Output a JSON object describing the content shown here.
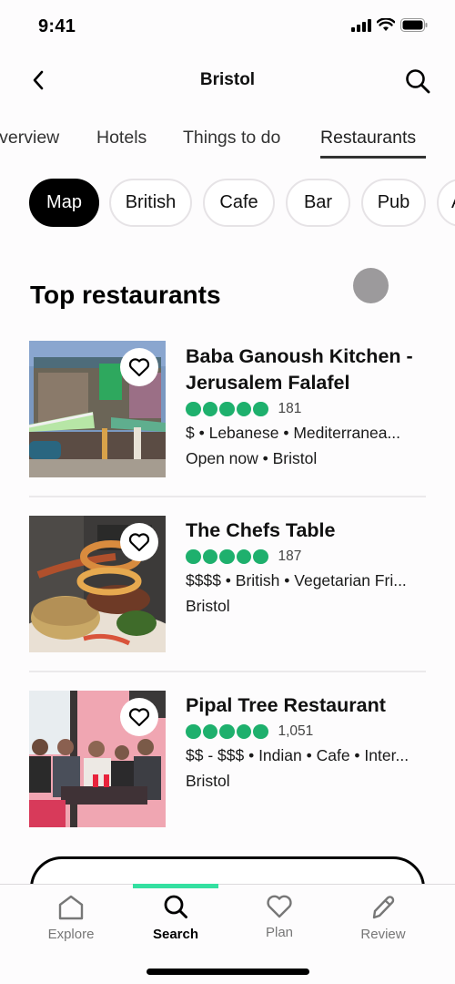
{
  "status_bar": {
    "time": "9:41"
  },
  "nav": {
    "title": "Bristol",
    "back_icon": "chevron-left-icon",
    "search_icon": "search-icon"
  },
  "tabs": [
    {
      "label": "Overview",
      "active": false
    },
    {
      "label": "Hotels",
      "active": false
    },
    {
      "label": "Things to do",
      "active": false
    },
    {
      "label": "Restaurants",
      "active": true
    }
  ],
  "chips": [
    {
      "label": "Map",
      "active": true
    },
    {
      "label": "British",
      "active": false
    },
    {
      "label": "Cafe",
      "active": false
    },
    {
      "label": "Bar",
      "active": false
    },
    {
      "label": "Pub",
      "active": false
    },
    {
      "label": "A",
      "active": false
    }
  ],
  "section": {
    "title": "Top restaurants"
  },
  "restaurants": [
    {
      "name": "Baba Ganoush Kitchen - Jerusalem Falafel",
      "rating": 5,
      "reviews": "181",
      "meta": "$ • Lebanese • Mediterranea...",
      "meta2": "Open now • Bristol",
      "image": "storefront-photo"
    },
    {
      "name": "The Chefs Table",
      "rating": 5,
      "reviews": "187",
      "meta": "$$$$ • British • Vegetarian Fri...",
      "meta2": "Bristol",
      "image": "food-plate-photo"
    },
    {
      "name": "Pipal Tree Restaurant",
      "rating": 5,
      "reviews": "1,051",
      "meta": "$$ - $$$ • Indian • Cafe • Inter...",
      "meta2": "Bristol",
      "image": "group-diners-photo"
    }
  ],
  "bottom_nav": [
    {
      "label": "Explore",
      "icon": "home-icon",
      "active": false
    },
    {
      "label": "Search",
      "icon": "search-icon",
      "active": true
    },
    {
      "label": "Plan",
      "icon": "heart-icon",
      "active": false
    },
    {
      "label": "Review",
      "icon": "pencil-icon",
      "active": false
    }
  ],
  "colors": {
    "rating_green": "#1eb06d",
    "active_tab_indicator": "#34e0a1",
    "chip_active_bg": "#000000"
  }
}
